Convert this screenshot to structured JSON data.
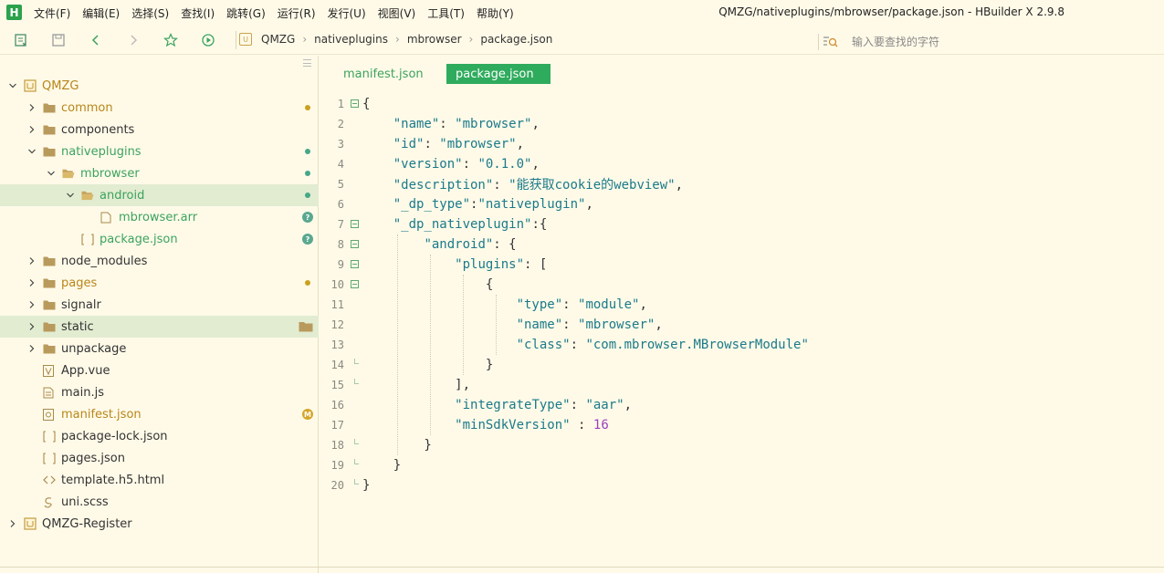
{
  "app": {
    "logo": "H",
    "window_title": "QMZG/nativeplugins/mbrowser/package.json - HBuilder X 2.9.8",
    "menus": [
      "文件(F)",
      "编辑(E)",
      "选择(S)",
      "查找(I)",
      "跳转(G)",
      "运行(R)",
      "发行(U)",
      "视图(V)",
      "工具(T)",
      "帮助(Y)"
    ]
  },
  "toolbar": {
    "icons": [
      "new-file-icon",
      "save-icon",
      "back-icon",
      "forward-icon",
      "star-icon",
      "run-icon"
    ],
    "breadcrumb_root_icon": "U",
    "breadcrumb": [
      "QMZG",
      "nativeplugins",
      "mbrowser",
      "package.json"
    ],
    "search": {
      "placeholder": "输入要查找的字符"
    }
  },
  "sidebar": {
    "items": [
      {
        "label": "QMZG",
        "chevron": "down",
        "icon": "project-icon",
        "color": "yellow",
        "badge": ""
      },
      {
        "label": "common",
        "chevron": "right",
        "icon": "folder-icon",
        "color": "yellow",
        "badge": "dot-yellow"
      },
      {
        "label": "components",
        "chevron": "right",
        "icon": "folder-icon",
        "color": "default",
        "badge": ""
      },
      {
        "label": "nativeplugins",
        "chevron": "down",
        "icon": "folder-icon",
        "color": "green",
        "badge": "dot-green"
      },
      {
        "label": "mbrowser",
        "chevron": "down",
        "icon": "folder-open-icon",
        "color": "green",
        "badge": "dot-green"
      },
      {
        "label": "android",
        "chevron": "down",
        "icon": "folder-open-icon",
        "color": "green",
        "badge": "dot-green"
      },
      {
        "label": "mbrowser.arr",
        "chevron": "",
        "icon": "file-icon",
        "color": "green",
        "badge": "?"
      },
      {
        "label": "package.json",
        "chevron": "",
        "icon": "json-icon",
        "color": "green",
        "badge": "?"
      },
      {
        "label": "node_modules",
        "chevron": "right",
        "icon": "folder-icon",
        "color": "default",
        "badge": ""
      },
      {
        "label": "pages",
        "chevron": "right",
        "icon": "folder-icon",
        "color": "yellow",
        "badge": "dot-yellow"
      },
      {
        "label": "signalr",
        "chevron": "right",
        "icon": "folder-icon",
        "color": "default",
        "badge": ""
      },
      {
        "label": "static",
        "chevron": "right",
        "icon": "folder-icon",
        "color": "default",
        "badge": "folder"
      },
      {
        "label": "unpackage",
        "chevron": "right",
        "icon": "folder-icon",
        "color": "default",
        "badge": ""
      },
      {
        "label": "App.vue",
        "chevron": "",
        "icon": "vue-icon",
        "color": "default",
        "badge": ""
      },
      {
        "label": "main.js",
        "chevron": "",
        "icon": "js-icon",
        "color": "default",
        "badge": ""
      },
      {
        "label": "manifest.json",
        "chevron": "",
        "icon": "manifest-icon",
        "color": "yellow",
        "badge": "M"
      },
      {
        "label": "package-lock.json",
        "chevron": "",
        "icon": "json-icon",
        "color": "default",
        "badge": ""
      },
      {
        "label": "pages.json",
        "chevron": "",
        "icon": "json-icon",
        "color": "default",
        "badge": ""
      },
      {
        "label": "template.h5.html",
        "chevron": "",
        "icon": "html-icon",
        "color": "default",
        "badge": ""
      },
      {
        "label": "uni.scss",
        "chevron": "",
        "icon": "scss-icon",
        "color": "default",
        "badge": ""
      },
      {
        "label": "QMZG-Register",
        "chevron": "right",
        "icon": "project-icon",
        "color": "default",
        "badge": ""
      }
    ]
  },
  "editor": {
    "tabs": [
      {
        "label": "manifest.json",
        "active": false
      },
      {
        "label": "package.json",
        "active": true
      }
    ],
    "lines": [
      {
        "n": "1",
        "text": "{"
      },
      {
        "n": "2",
        "text": "    \"name\": \"mbrowser\","
      },
      {
        "n": "3",
        "text": "    \"id\": \"mbrowser\","
      },
      {
        "n": "4",
        "text": "    \"version\": \"0.1.0\","
      },
      {
        "n": "5",
        "text": "    \"description\": \"能获取cookie的webview\","
      },
      {
        "n": "6",
        "text": "    \"_dp_type\":\"nativeplugin\","
      },
      {
        "n": "7",
        "text": "    \"_dp_nativeplugin\":{"
      },
      {
        "n": "8",
        "text": "        \"android\": {"
      },
      {
        "n": "9",
        "text": "            \"plugins\": ["
      },
      {
        "n": "10",
        "text": "                {"
      },
      {
        "n": "11",
        "text": "                    \"type\": \"module\","
      },
      {
        "n": "12",
        "text": "                    \"name\": \"mbrowser\","
      },
      {
        "n": "13",
        "text": "                    \"class\": \"com.mbrowser.MBrowserModule\""
      },
      {
        "n": "14",
        "text": "                }"
      },
      {
        "n": "15",
        "text": "            ],"
      },
      {
        "n": "16",
        "text": "            \"integrateType\": \"aar\","
      },
      {
        "n": "17",
        "text": "            \"minSdkVersion\" : 16"
      },
      {
        "n": "18",
        "text": "        }"
      },
      {
        "n": "19",
        "text": "    }"
      },
      {
        "n": "20",
        "text": "}"
      }
    ]
  },
  "colors": {
    "background": "#fffae8",
    "accent_green": "#2fab5d",
    "tree_green": "#3ca35f",
    "tree_yellow": "#b8861a",
    "json_key": "#1a7a8a",
    "json_number": "#9c3fc0",
    "selection": "#e2ecd1"
  }
}
